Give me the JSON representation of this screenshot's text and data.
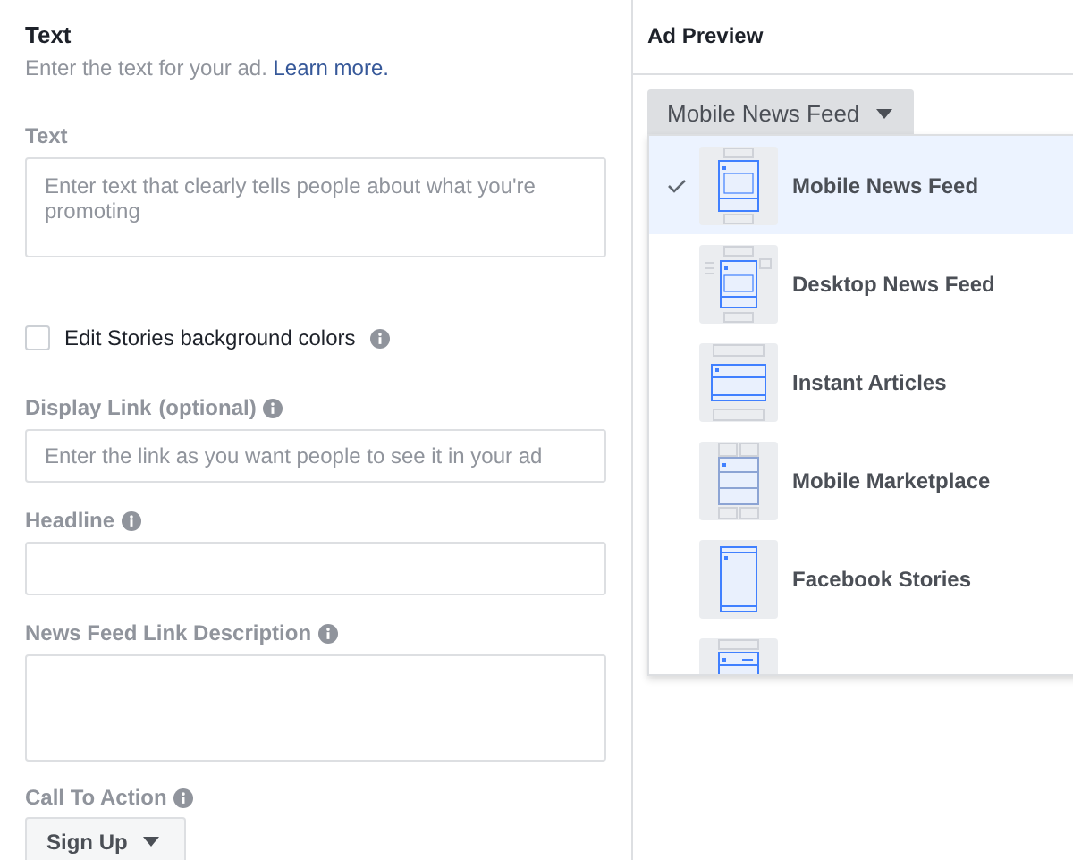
{
  "editor": {
    "title": "Text",
    "subtitle": "Enter the text for your ad.",
    "learn_more": "Learn more.",
    "text_field": {
      "label": "Text",
      "placeholder": "Enter text that clearly tells people about what you're promoting"
    },
    "stories_checkbox": {
      "label": "Edit Stories background colors",
      "checked": false
    },
    "display_link": {
      "label": "Display Link",
      "hint": "(optional)",
      "placeholder": "Enter the link as you want people to see it in your ad"
    },
    "headline": {
      "label": "Headline"
    },
    "description": {
      "label": "News Feed Link Description"
    },
    "call_to_action": {
      "label": "Call To Action",
      "value": "Sign Up"
    }
  },
  "preview": {
    "title": "Ad Preview",
    "placement_dropdown": {
      "value": "Mobile News Feed",
      "expanded": true
    },
    "placements": [
      {
        "kind": "mobile-feed",
        "label": "Mobile News Feed",
        "selected": true
      },
      {
        "kind": "desktop-feed",
        "label": "Desktop News Feed",
        "selected": false
      },
      {
        "kind": "instant-articles",
        "label": "Instant Articles",
        "selected": false
      },
      {
        "kind": "marketplace",
        "label": "Mobile Marketplace",
        "selected": false
      },
      {
        "kind": "stories",
        "label": "Facebook Stories",
        "selected": false
      },
      {
        "kind": "instagram",
        "selected": false
      }
    ]
  }
}
